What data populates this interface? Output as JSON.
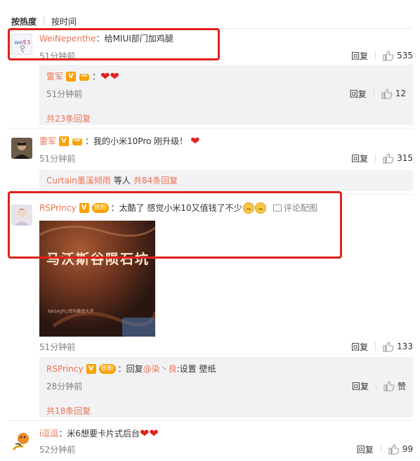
{
  "sort": {
    "hot": "按热度",
    "time": "按时间"
  },
  "comments": [
    {
      "user": "WeiNepenthe",
      "text": "给MIUI部门加鸡腿",
      "time": "51分钟前",
      "reply": "回复",
      "likes": "535",
      "sub": {
        "user": "雷军",
        "time": "51分钟前",
        "reply": "回复",
        "likes": "12",
        "more": "共23条回复"
      }
    },
    {
      "user": "雷军",
      "text": "我的小米10Pro 刚升级！",
      "time": "51分钟前",
      "reply": "回复",
      "likes": "315",
      "sub_line": {
        "user": "Curtain墨溪倾雨",
        "mid": "等人",
        "more": "共84条回复"
      }
    },
    {
      "user": "RSPrincy",
      "fan_badge": "铁粉",
      "text": "太酷了 感觉小米10又值钱了不少",
      "pic_link": "评论配图",
      "image": {
        "title": "马沃斯谷陨石坑",
        "caption": "NASA/JPL/亚利桑那大学"
      },
      "time": "51分钟前",
      "reply": "回复",
      "likes": "133",
      "sub": {
        "user": "RSPrincy",
        "fan_badge": "铁粉",
        "text_prefix": "回复",
        "mention": "@染丶良",
        "text_suffix": ":设置 壁纸",
        "time": "28分钟前",
        "reply": "回复",
        "likes": "赞",
        "more": "共18条回复"
      }
    },
    {
      "user": "i逗逗",
      "text": "米6想要卡片式后台",
      "time": "52分钟前",
      "reply": "回复",
      "likes": "99"
    }
  ],
  "colors": {
    "accent": "#eb7350",
    "highlight": "#e0211d",
    "badge": "#f8a200"
  }
}
